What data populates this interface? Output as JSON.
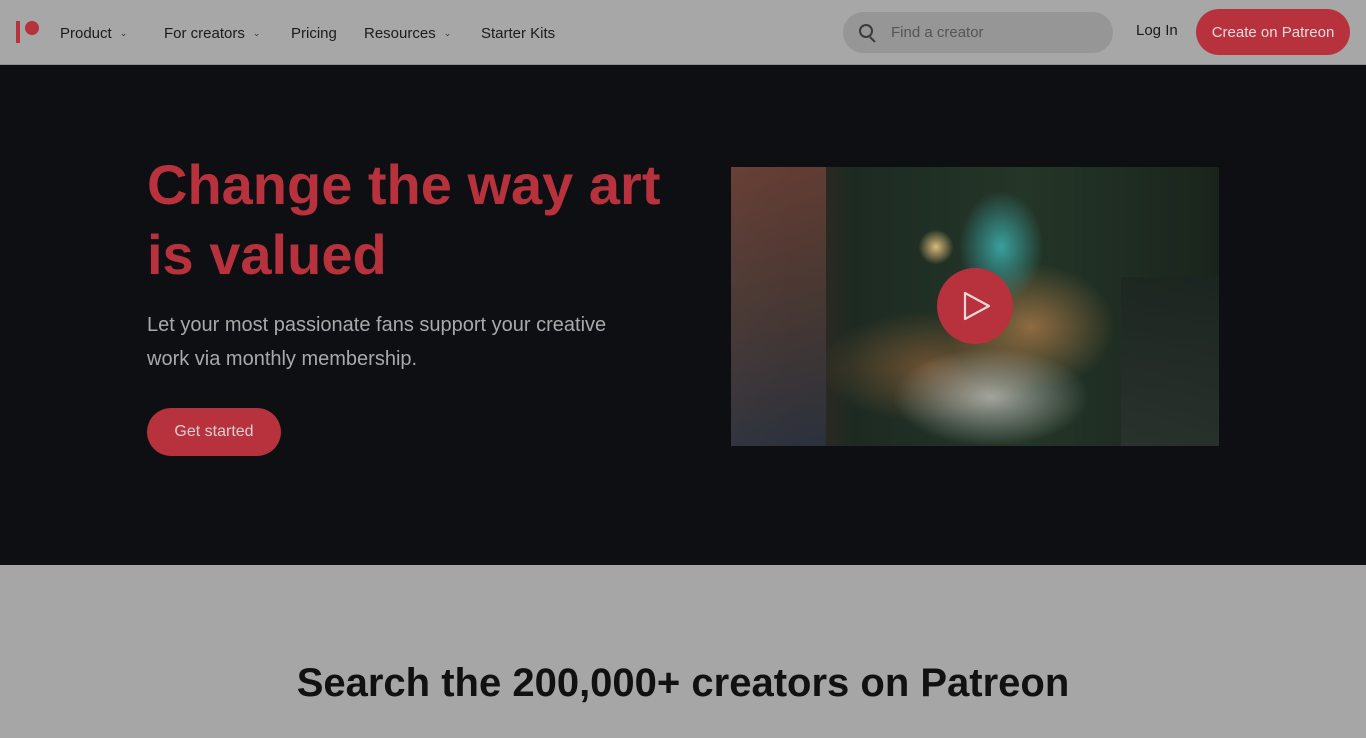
{
  "nav": {
    "items": [
      {
        "label": "Product",
        "dropdown": true
      },
      {
        "label": "For creators",
        "dropdown": true
      },
      {
        "label": "Pricing",
        "dropdown": false
      },
      {
        "label": "Resources",
        "dropdown": true
      },
      {
        "label": "Starter Kits",
        "dropdown": false
      }
    ],
    "search_placeholder": "Find a creator",
    "login_label": "Log In",
    "cta_label": "Create on Patreon"
  },
  "hero": {
    "title": "Change the way art is valued",
    "subtitle": "Let your most passionate fans support your creative work via monthly membership.",
    "cta_label": "Get started"
  },
  "section": {
    "title": "Search the 200,000+ creators on Patreon"
  },
  "colors": {
    "brand": "#b8323e",
    "hero_bg": "#0e0f12",
    "page_bg": "#a6a6a6"
  }
}
